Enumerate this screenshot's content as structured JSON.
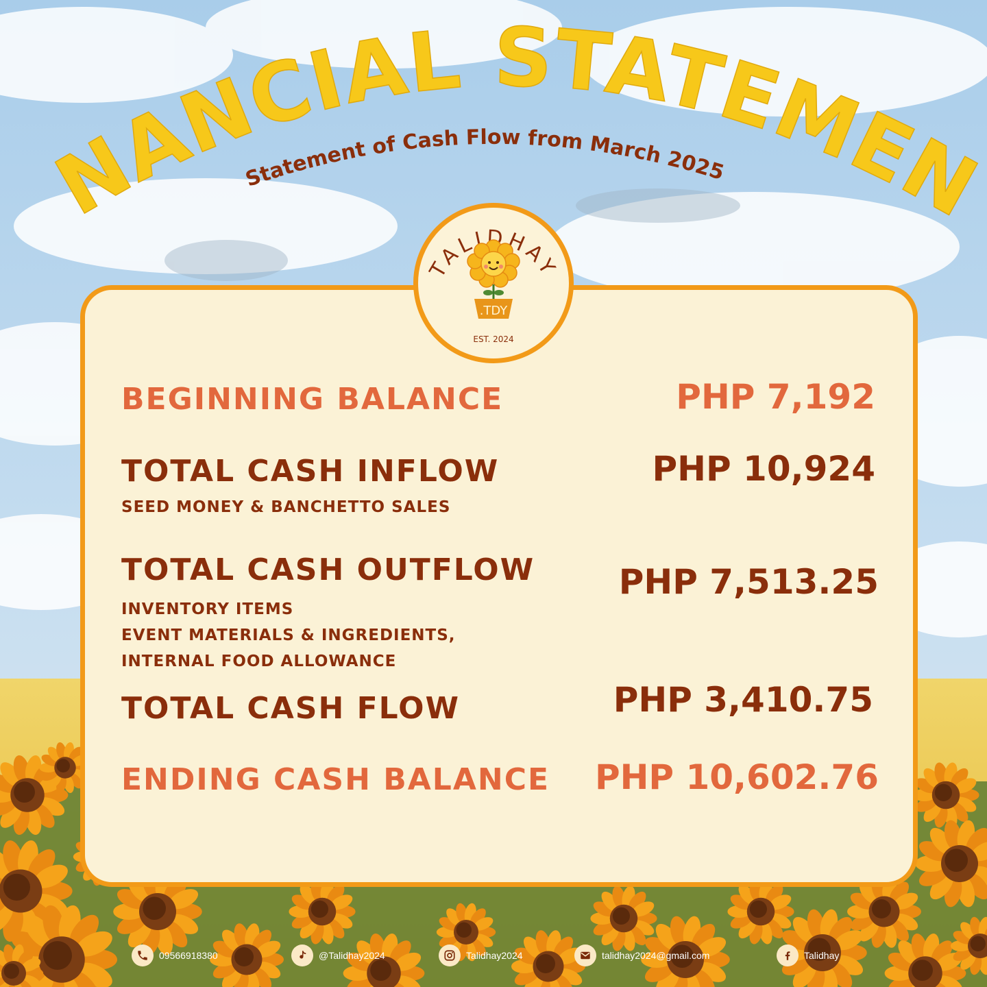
{
  "header": {
    "title": "FINANCIAL STATEMENT",
    "subtitle": "Statement of Cash Flow from March 2025"
  },
  "logo": {
    "brand": "TALIDHAY",
    "pot_text": ".TDY",
    "established": "EST. 2024"
  },
  "statement": {
    "beginning": {
      "label": "BEGINNING BALANCE",
      "value": "PHP 7,192"
    },
    "inflow": {
      "label": "TOTAL CASH INFLOW",
      "value": "PHP  10,924",
      "notes": [
        "SEED MONEY & BANCHETTO SALES"
      ]
    },
    "outflow": {
      "label": "TOTAL CASH OUTFLOW",
      "value": "PHP 7,513.25",
      "notes": [
        "INVENTORY ITEMS",
        "EVENT MATERIALS & INGREDIENTS,",
        "INTERNAL FOOD ALLOWANCE"
      ]
    },
    "cashflow": {
      "label": "TOTAL CASH FLOW",
      "value": "PHP 3,410.75"
    },
    "ending": {
      "label": "ENDING CASH BALANCE",
      "value": "PHP 10,602.76"
    }
  },
  "footer": {
    "phone": {
      "icon": "phone-icon",
      "text": "09566918380"
    },
    "tiktok": {
      "icon": "music-note-icon",
      "text": "@Talidhay2024"
    },
    "instagram": {
      "icon": "instagram-icon",
      "text": "Talidhay2024"
    },
    "email": {
      "icon": "mail-icon",
      "text": "talidhay2024@gmail.com"
    },
    "facebook": {
      "icon": "facebook-icon",
      "text": "Talidhay"
    }
  },
  "colors": {
    "card_border": "#f29a18",
    "card_fill": "#fbf2d6",
    "orange_text": "#e2683d",
    "brown_text": "#8a2e0b",
    "title_yellow": "#f7c81a",
    "title_shadow": "#4f5a2c"
  }
}
